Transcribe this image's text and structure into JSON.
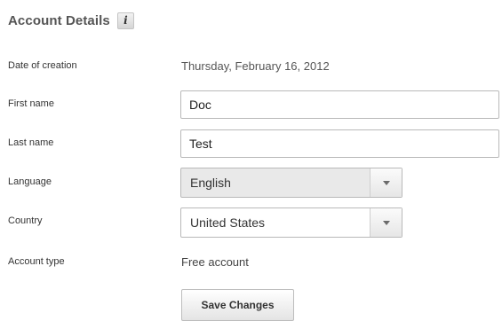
{
  "section": {
    "title": "Account Details",
    "info_icon": "info-icon",
    "info_glyph": "i"
  },
  "fields": {
    "date_of_creation": {
      "label": "Date of creation",
      "value": "Thursday, February 16, 2012"
    },
    "first_name": {
      "label": "First name",
      "value": "Doc"
    },
    "last_name": {
      "label": "Last name",
      "value": "Test"
    },
    "language": {
      "label": "Language",
      "selected": "English",
      "disabled": true
    },
    "country": {
      "label": "Country",
      "selected": "United States",
      "disabled": false
    },
    "account_type": {
      "label": "Account type",
      "value": "Free account"
    }
  },
  "actions": {
    "save_label": "Save Changes"
  },
  "icons": {
    "dropdown": "chevron-down-icon"
  },
  "colors": {
    "heading_text": "#555555",
    "input_border": "#b9b9b9",
    "disabled_select_bg": "#e9e9e9"
  }
}
